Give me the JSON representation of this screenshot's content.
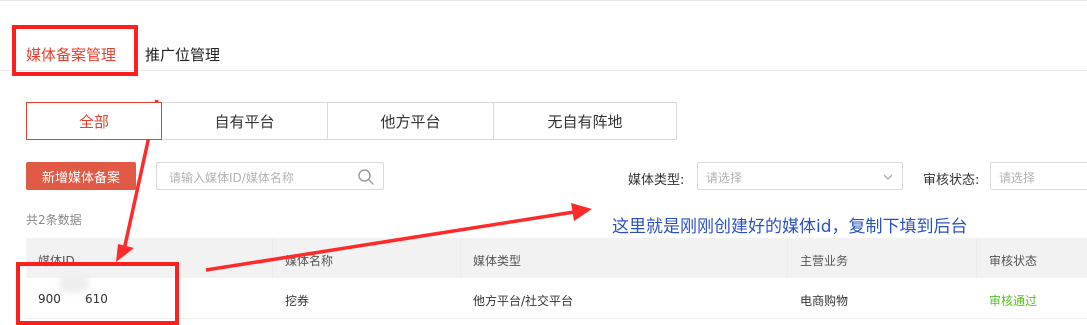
{
  "top_tabs": [
    {
      "label": "媒体备案管理",
      "active": true
    },
    {
      "label": "推广位管理",
      "active": false
    }
  ],
  "segments": [
    {
      "label": "全部",
      "active": true
    },
    {
      "label": "自有平台",
      "active": false
    },
    {
      "label": "他方平台",
      "active": false
    },
    {
      "label": "无自有阵地",
      "active": false
    }
  ],
  "toolbar": {
    "add_label": "新增媒体备案",
    "search_placeholder": "请输入媒体ID/媒体名称",
    "media_type_label": "媒体类型:",
    "media_type_placeholder": "请选择",
    "review_status_label": "审核状态:",
    "review_status_placeholder": "请选择"
  },
  "count_text": "共2条数据",
  "table": {
    "headers": [
      "媒体ID",
      "媒体名称",
      "媒体类型",
      "主营业务",
      "审核状态"
    ],
    "rows": [
      {
        "media_id_prefix": "900",
        "media_id_suffix": "610",
        "name": "挖券",
        "type": "他方平台/社交平台",
        "business": "电商购物",
        "status": "审核通过"
      }
    ]
  },
  "annotation": {
    "text": "这里就是刚刚创建好的媒体id，复制下填到后台"
  },
  "colors": {
    "accent": "#e3412d",
    "annotation_red": "#ff1f1f",
    "annotation_blue": "#2a52c4",
    "status_green": "#52c41a"
  }
}
